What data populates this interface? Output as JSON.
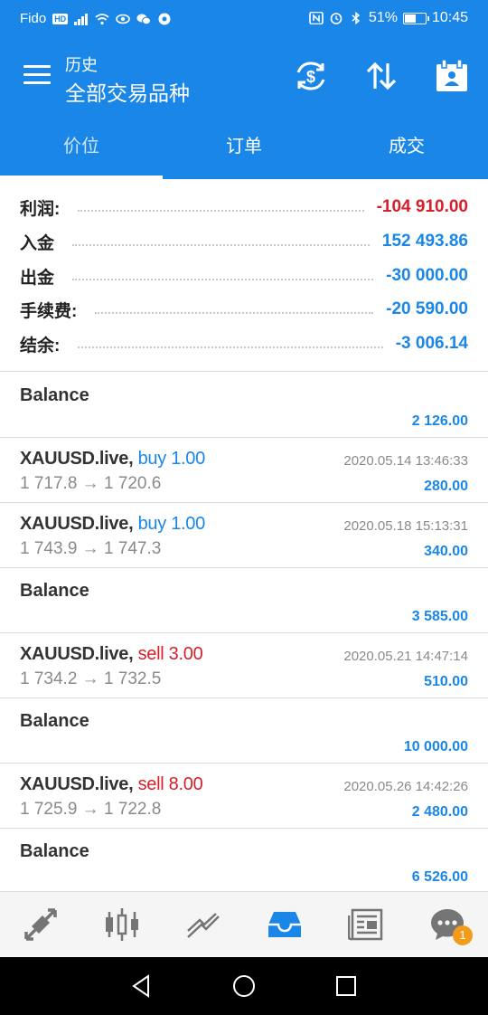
{
  "status": {
    "carrier": "Fido",
    "hd": "HD",
    "battery_text": "51%",
    "battery_level": 0.51,
    "time": "10:45"
  },
  "appbar": {
    "title_small": "历史",
    "title_big": "全部交易品种"
  },
  "tabs": [
    {
      "label": "价位",
      "active": true
    },
    {
      "label": "订单",
      "active": false
    },
    {
      "label": "成交",
      "active": false
    }
  ],
  "summary": [
    {
      "label": "利润:",
      "value": "-104 910.00",
      "color": "#d81e2a"
    },
    {
      "label": "入金",
      "value": "152 493.86",
      "color": "#1a87e8"
    },
    {
      "label": "出金",
      "value": "-30 000.00",
      "color": "#1a87e8"
    },
    {
      "label": "手续费:",
      "value": "-20 590.00",
      "color": "#1a87e8"
    },
    {
      "label": "结余:",
      "value": "-3 006.14",
      "color": "#1a87e8"
    }
  ],
  "items": [
    {
      "type": "balance",
      "label": "Balance",
      "amount": "2 126.00"
    },
    {
      "type": "deal",
      "symbol": "XAUUSD.live,",
      "side": "buy",
      "volume": "buy 1.00",
      "prices": "1 717.8 → 1 720.6",
      "date": "2020.05.14 13:46:33",
      "profit": "280.00"
    },
    {
      "type": "deal",
      "symbol": "XAUUSD.live,",
      "side": "buy",
      "volume": "buy 1.00",
      "prices": "1 743.9 → 1 747.3",
      "date": "2020.05.18 15:13:31",
      "profit": "340.00"
    },
    {
      "type": "balance",
      "label": "Balance",
      "amount": "3 585.00"
    },
    {
      "type": "deal",
      "symbol": "XAUUSD.live,",
      "side": "sell",
      "volume": "sell 3.00",
      "prices": "1 734.2 → 1 732.5",
      "date": "2020.05.21 14:47:14",
      "profit": "510.00"
    },
    {
      "type": "balance",
      "label": "Balance",
      "amount": "10 000.00"
    },
    {
      "type": "deal",
      "symbol": "XAUUSD.live,",
      "side": "sell",
      "volume": "sell 8.00",
      "prices": "1 725.9 → 1 722.8",
      "date": "2020.05.26 14:42:26",
      "profit": "2 480.00"
    },
    {
      "type": "balance",
      "label": "Balance",
      "amount": "6 526.00"
    }
  ],
  "bottom_nav": [
    {
      "icon": "quotes-arrows-icon",
      "active": false
    },
    {
      "icon": "candlestick-chart-icon",
      "active": false
    },
    {
      "icon": "trade-lines-icon",
      "active": false
    },
    {
      "icon": "history-inbox-icon",
      "active": true
    },
    {
      "icon": "news-icon",
      "active": false
    },
    {
      "icon": "chat-icon",
      "active": false,
      "badge": "1"
    }
  ],
  "colors": {
    "primary": "#1a87e8",
    "negative": "#d81e2a",
    "badge": "#f39c1c"
  }
}
